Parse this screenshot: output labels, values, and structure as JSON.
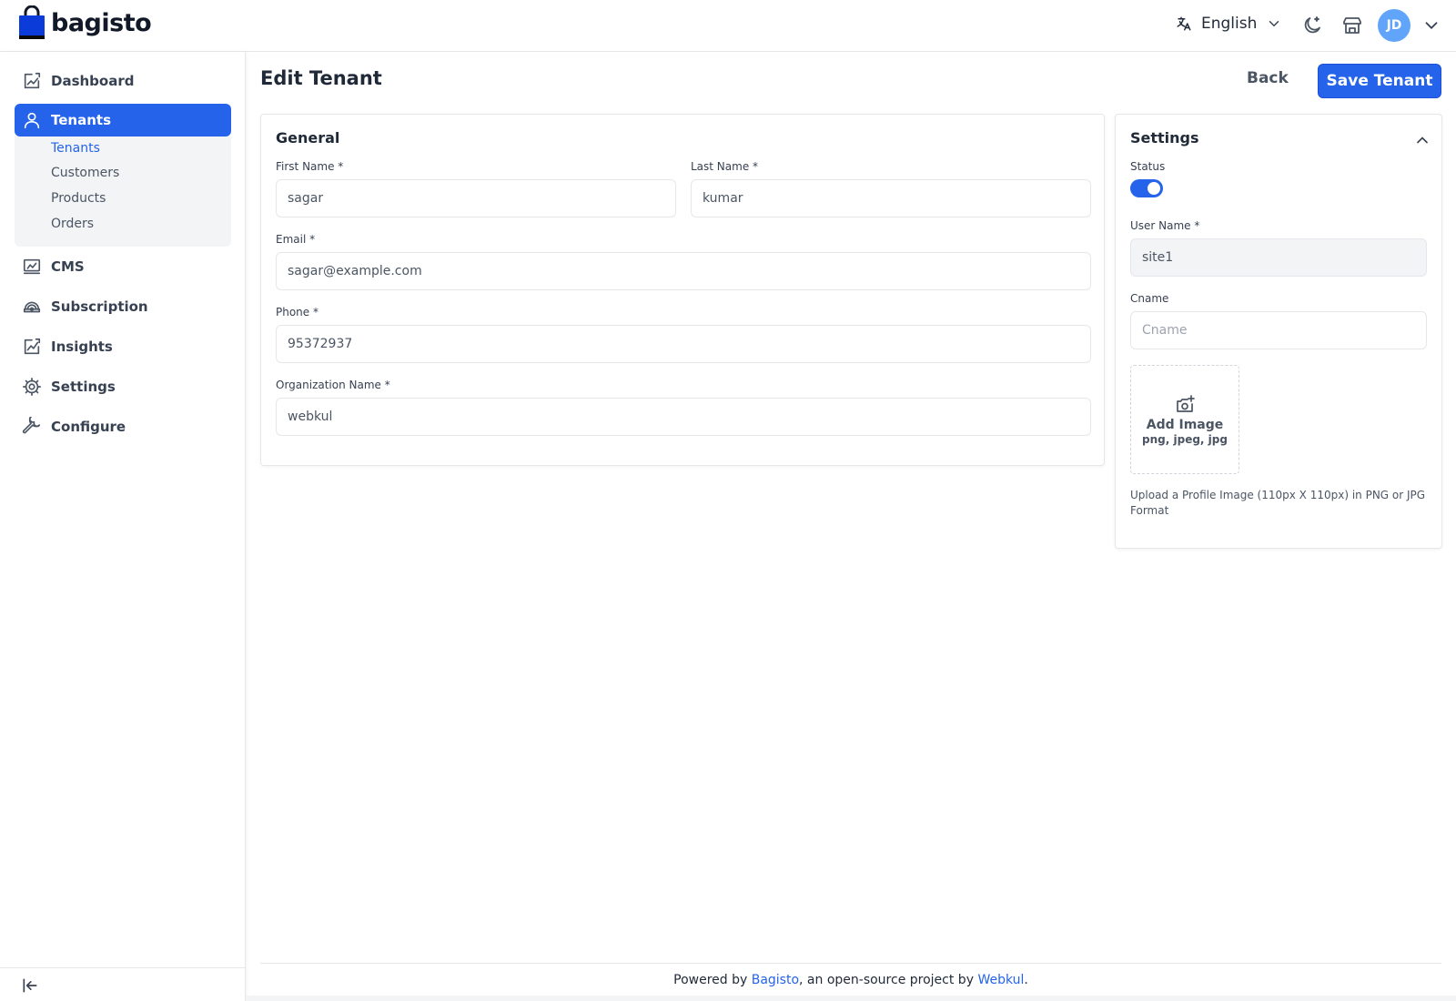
{
  "header": {
    "logo_text": "bagisto",
    "language": "English",
    "user_initials": "JD",
    "icons": [
      "translate-icon",
      "chevron-down-icon",
      "dark-mode-icon",
      "storefront-icon",
      "chevron-down-icon"
    ]
  },
  "sidebar": {
    "items": [
      {
        "label": "Dashboard",
        "icon": "dashboard-icon"
      },
      {
        "label": "Tenants",
        "icon": "tenants-icon",
        "active": true
      },
      {
        "label": "CMS",
        "icon": "cms-icon"
      },
      {
        "label": "Subscription",
        "icon": "subscription-icon"
      },
      {
        "label": "Insights",
        "icon": "insights-icon"
      },
      {
        "label": "Settings",
        "icon": "settings-icon"
      },
      {
        "label": "Configure",
        "icon": "configure-icon"
      }
    ],
    "subitems": [
      {
        "label": "Tenants",
        "active": true
      },
      {
        "label": "Customers"
      },
      {
        "label": "Products"
      },
      {
        "label": "Orders"
      }
    ]
  },
  "page": {
    "title": "Edit Tenant",
    "back_label": "Back",
    "save_label": "Save Tenant"
  },
  "general": {
    "title": "General",
    "first_name_label": "First Name *",
    "first_name_value": "sagar",
    "last_name_label": "Last Name *",
    "last_name_value": "kumar",
    "email_label": "Email *",
    "email_value": "sagar@example.com",
    "phone_label": "Phone *",
    "phone_value": "95372937",
    "org_label": "Organization Name *",
    "org_value": "webkul"
  },
  "settings": {
    "title": "Settings",
    "status_label": "Status",
    "status_on": true,
    "username_label": "User Name *",
    "username_value": "site1",
    "cname_label": "Cname",
    "cname_placeholder": "Cname",
    "add_image_label": "Add Image",
    "image_types": "png, jpeg, jpg",
    "image_hint": "Upload a Profile Image (110px X 110px) in PNG or JPG Format"
  },
  "footer": {
    "prefix": "Powered by ",
    "bagisto_link": "Bagisto",
    "middle": ", an open-source project by ",
    "webkul_link": "Webkul",
    "suffix": "."
  },
  "colors": {
    "primary": "#2563eb",
    "avatar": "#60a5fa",
    "submenu_bg": "#f3f4f6"
  }
}
